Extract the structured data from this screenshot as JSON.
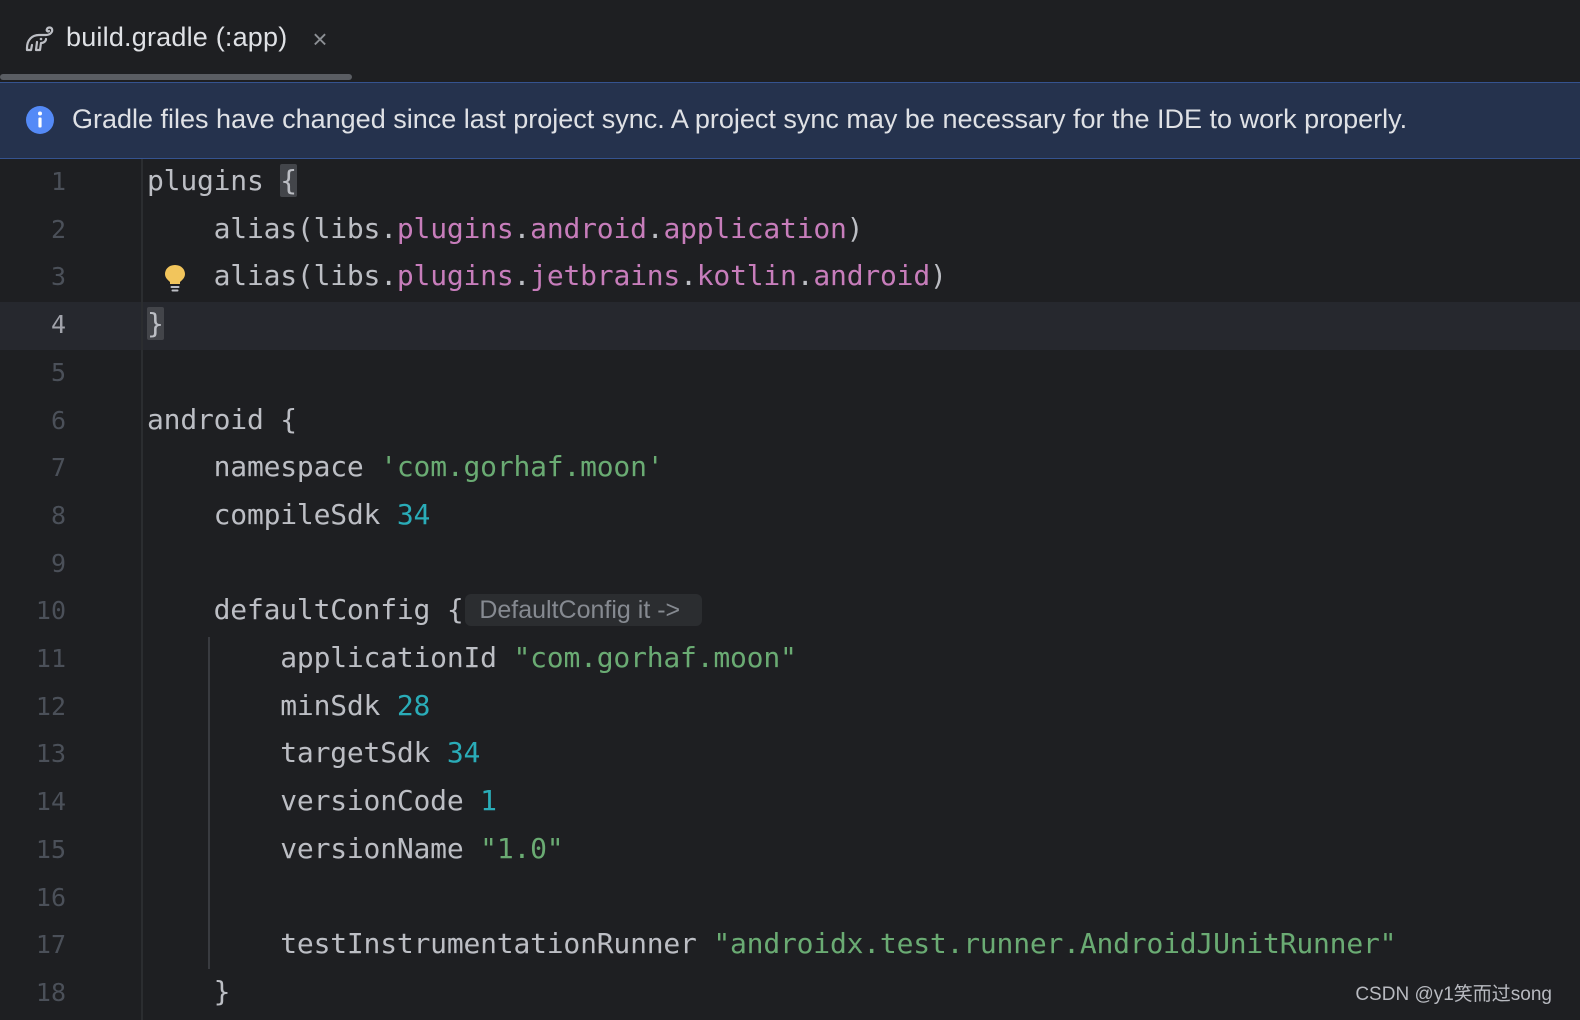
{
  "tab": {
    "title": "build.gradle (:app)",
    "close_glyph": "×",
    "icon": "gradle-elephant-icon"
  },
  "banner": {
    "icon": "info-icon",
    "text": "Gradle files have changed since last project sync. A project sync may be necessary for the IDE to work properly."
  },
  "editor": {
    "current_line": 4,
    "lines": [
      {
        "n": "1",
        "tokens": [
          [
            "kw",
            "plugins "
          ],
          [
            "hlbrace",
            "{"
          ]
        ]
      },
      {
        "n": "2",
        "tokens": [
          [
            "kw",
            "    alias(libs."
          ],
          [
            "prop",
            "plugins"
          ],
          [
            "kw",
            "."
          ],
          [
            "prop",
            "android"
          ],
          [
            "kw",
            "."
          ],
          [
            "prop",
            "application"
          ],
          [
            "kw",
            ")"
          ]
        ]
      },
      {
        "n": "3",
        "tokens": [
          [
            "kw",
            "    alias(libs."
          ],
          [
            "prop",
            "plugins"
          ],
          [
            "kw",
            "."
          ],
          [
            "prop",
            "jetbrains"
          ],
          [
            "kw",
            "."
          ],
          [
            "prop",
            "kotlin"
          ],
          [
            "kw",
            "."
          ],
          [
            "prop",
            "android"
          ],
          [
            "kw",
            ")"
          ]
        ],
        "bulb": true
      },
      {
        "n": "4",
        "tokens": [
          [
            "hlbrace",
            "}"
          ]
        ]
      },
      {
        "n": "5",
        "tokens": []
      },
      {
        "n": "6",
        "tokens": [
          [
            "kw",
            "android {"
          ]
        ]
      },
      {
        "n": "7",
        "tokens": [
          [
            "kw",
            "    namespace "
          ],
          [
            "str",
            "'com.gorhaf.moon'"
          ]
        ]
      },
      {
        "n": "8",
        "tokens": [
          [
            "kw",
            "    compileSdk "
          ],
          [
            "num",
            "34"
          ]
        ]
      },
      {
        "n": "9",
        "tokens": []
      },
      {
        "n": "10",
        "tokens": [
          [
            "kw",
            "    defaultConfig {"
          ]
        ],
        "hint": "DefaultConfig it ->"
      },
      {
        "n": "11",
        "tokens": [
          [
            "kw",
            "        applicationId "
          ],
          [
            "str",
            "\"com.gorhaf.moon\""
          ]
        ]
      },
      {
        "n": "12",
        "tokens": [
          [
            "kw",
            "        minSdk "
          ],
          [
            "num",
            "28"
          ]
        ]
      },
      {
        "n": "13",
        "tokens": [
          [
            "kw",
            "        targetSdk "
          ],
          [
            "num",
            "34"
          ]
        ]
      },
      {
        "n": "14",
        "tokens": [
          [
            "kw",
            "        versionCode "
          ],
          [
            "num",
            "1"
          ]
        ]
      },
      {
        "n": "15",
        "tokens": [
          [
            "kw",
            "        versionName "
          ],
          [
            "str",
            "\"1.0\""
          ]
        ]
      },
      {
        "n": "16",
        "tokens": []
      },
      {
        "n": "17",
        "tokens": [
          [
            "kw",
            "        testInstrumentationRunner "
          ],
          [
            "str",
            "\"androidx.test.runner.AndroidJUnitRunner\""
          ]
        ]
      },
      {
        "n": "18",
        "tokens": [
          [
            "kw",
            "    }"
          ]
        ]
      }
    ]
  },
  "watermark": "CSDN @y1笑而过song",
  "colors": {
    "background": "#1e1f22",
    "banner_bg": "#25324d",
    "string": "#6aab73",
    "number": "#2aacb8",
    "property": "#c77dbb",
    "text": "#bcbec4",
    "info_blue": "#548af7"
  }
}
